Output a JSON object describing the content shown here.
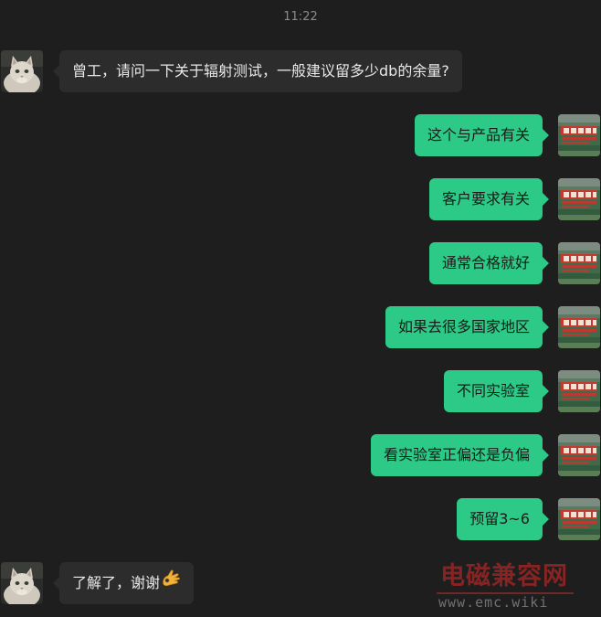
{
  "chat": {
    "timestamp": "11:22",
    "messages": [
      {
        "side": "left",
        "text": "曾工，请问一下关于辐射测试，一般建议留多少db的余量?"
      },
      {
        "side": "right",
        "text": "这个与产品有关"
      },
      {
        "side": "right",
        "text": "客户要求有关"
      },
      {
        "side": "right",
        "text": "通常合格就好"
      },
      {
        "side": "right",
        "text": "如果去很多国家地区"
      },
      {
        "side": "right",
        "text": "不同实验室"
      },
      {
        "side": "right",
        "text": "看实验室正偏还是负偏"
      },
      {
        "side": "right",
        "text": "预留3~6"
      },
      {
        "side": "left",
        "text": "了解了，谢谢",
        "emoji": "ok-hand-emoji"
      }
    ]
  },
  "colors": {
    "background": "#1e1e1e",
    "outgoing_bubble": "#2dc986",
    "incoming_bubble": "#2c2c2c",
    "timestamp_text": "#8b8b8b"
  },
  "watermark": {
    "title": "电磁兼容网",
    "url": "www.emc.wiki"
  }
}
